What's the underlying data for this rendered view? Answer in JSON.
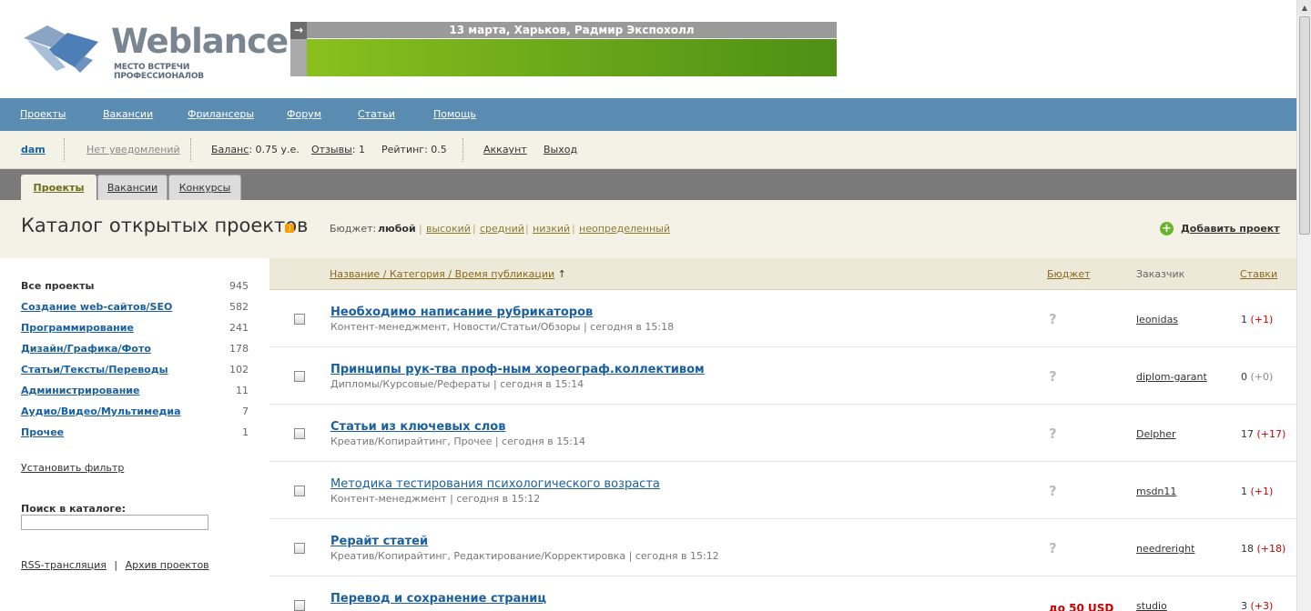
{
  "logo": {
    "brand": "Weblancer",
    "tagline": "МЕСТО ВСТРЕЧИ ПРОФЕССИОНАЛОВ"
  },
  "banner": {
    "text": "13 марта, Харьков, Радмир Экспохолл"
  },
  "nav": [
    "Проекты",
    "Вакансии",
    "Фрилансеры",
    "Форум",
    "Статьи",
    "Помощь"
  ],
  "userbar": {
    "username": "dam",
    "notifications": "Нет уведомлений",
    "balance_label": "Баланс",
    "balance_value": ": 0.75 у.е.",
    "reviews_label": "Отзывы",
    "reviews_value": ": 1",
    "rating": "Рейтинг: 0.5",
    "account": "Аккаунт",
    "logout": "Выход"
  },
  "tabs": [
    "Проекты",
    "Вакансии",
    "Конкурсы"
  ],
  "catalog": {
    "title": "Каталог открытых проектов",
    "budget_label": "Бюджет:",
    "budget_options": [
      "любой",
      "высокий",
      "средний",
      "низкий",
      "неопределенный"
    ],
    "add_project": "Добавить проект"
  },
  "sidebar": {
    "categories": [
      {
        "name": "Все проекты",
        "count": "945"
      },
      {
        "name": "Создание web-сайтов/SEO",
        "count": "582"
      },
      {
        "name": "Программирование",
        "count": "241"
      },
      {
        "name": "Дизайн/Графика/Фото",
        "count": "178"
      },
      {
        "name": "Статьи/Тексты/Переводы",
        "count": "102"
      },
      {
        "name": "Администрирование",
        "count": "11"
      },
      {
        "name": "Аудио/Видео/Мультимедиа",
        "count": "7"
      },
      {
        "name": "Прочее",
        "count": "1"
      }
    ],
    "filter": "Установить фильтр",
    "search_label": "Поиск в каталоге:",
    "rss": "RSS-трансляция",
    "archive": "Архив проектов"
  },
  "list_header": {
    "name": "Название / Категория / Время публикации",
    "budget": "Бюджет",
    "customer": "Заказчик",
    "bids": "Ставки"
  },
  "projects": [
    {
      "title": "Необходимо написание рубрикаторов",
      "meta": "Контент-менеджмент, Новости/Статьи/Обзоры | сегодня в 15:18",
      "budget": "?",
      "customer": "leonidas",
      "bids": "1",
      "delta": "(+1)"
    },
    {
      "title": "Принципы рук-тва проф-ным хореограф.коллективом",
      "meta": "Дипломы/Курсовые/Рефераты | сегодня в 15:14",
      "budget": "?",
      "customer": "diplom-garant",
      "bids": "0",
      "delta": "(+0)"
    },
    {
      "title": "Статьи из ключевых слов",
      "meta": "Креатив/Копирайтинг, Прочее | сегодня в 15:14",
      "budget": "?",
      "customer": "Delpher",
      "bids": "17",
      "delta": "(+17)"
    },
    {
      "title": "Методика тестирования психологического возраста",
      "meta": "Контент-менеджмент | сегодня в 15:12",
      "budget": "?",
      "customer": "msdn11",
      "bids": "1",
      "delta": "(+1)"
    },
    {
      "title": "Рерайт статей",
      "meta": "Креатив/Копирайтинг, Редактирование/Корректировка | сегодня в 15:12",
      "budget": "?",
      "customer": "needreright",
      "bids": "18",
      "delta": "(+18)"
    },
    {
      "title": "Перевод и сохранение страниц",
      "meta": "",
      "budget": "до 50 USD",
      "customer": "studio",
      "bids": "3",
      "delta": "(+3)"
    }
  ]
}
